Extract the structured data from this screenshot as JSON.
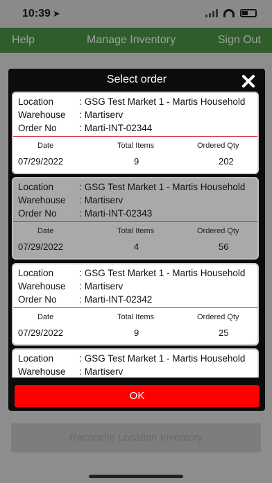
{
  "status": {
    "time": "10:39",
    "arrow": "➤"
  },
  "appbar": {
    "help": "Help",
    "manage": "Manage Inventory",
    "signout": "Sign Out"
  },
  "background": {
    "reconcile_label": "Reconcile Location Inventory"
  },
  "modal": {
    "title": "Select order",
    "ok_label": "OK",
    "labels": {
      "location": "Location",
      "warehouse": "Warehouse",
      "order_no": "Order No",
      "sep": ":"
    },
    "columns": {
      "date": "Date",
      "total_items": "Total Items",
      "ordered_qty": "Ordered Qty"
    },
    "orders": [
      {
        "location": "GSG Test Market 1 - Martis Household",
        "warehouse": "Martiserv",
        "order_no": "Marti-INT-02344",
        "date": "07/29/2022",
        "total_items": "9",
        "ordered_qty": "202",
        "selected": false
      },
      {
        "location": "GSG Test Market 1 - Martis Household",
        "warehouse": "Martiserv",
        "order_no": "Marti-INT-02343",
        "date": "07/29/2022",
        "total_items": "4",
        "ordered_qty": "56",
        "selected": true
      },
      {
        "location": "GSG Test Market 1 - Martis Household",
        "warehouse": "Martiserv",
        "order_no": "Marti-INT-02342",
        "date": "07/29/2022",
        "total_items": "9",
        "ordered_qty": "25",
        "selected": false
      },
      {
        "location": "GSG Test Market 1 - Martis Household",
        "warehouse": "Martiserv",
        "order_no": "",
        "date": "",
        "total_items": "",
        "ordered_qty": "",
        "selected": false
      }
    ]
  },
  "colors": {
    "accent_red": "#ff0000",
    "appbar_green": "#2f5e2c",
    "selected_row": "#a9a9a9"
  }
}
